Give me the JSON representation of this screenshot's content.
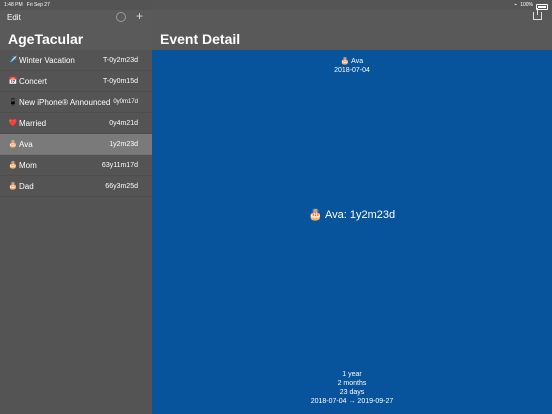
{
  "status": {
    "time": "1:48 PM",
    "date": "Fri Sep 27",
    "battery": "100%"
  },
  "sidebar": {
    "edit_label": "Edit",
    "add_label": "+",
    "title": "AgeTacular",
    "items": [
      {
        "emoji": "✈️",
        "name": "Winter Vacation",
        "age": "T-0y2m23d"
      },
      {
        "emoji": "📅",
        "name": "Concert",
        "age": "T-0y0m15d"
      },
      {
        "emoji": "📱",
        "name": "New iPhone® Announced",
        "age": "0y0m17d"
      },
      {
        "emoji": "❤️",
        "name": "Married",
        "age": "0y4m21d"
      },
      {
        "emoji": "🎂",
        "name": "Ava",
        "age": "1y2m23d"
      },
      {
        "emoji": "🎂",
        "name": "Mom",
        "age": "63y11m17d"
      },
      {
        "emoji": "🎂",
        "name": "Dad",
        "age": "66y3m25d"
      }
    ]
  },
  "detail": {
    "header_title": "Event Detail",
    "top_name": "🎂 Ava",
    "top_date": "2018-07-04",
    "big_text": "🎂 Ava: 1y2m23d",
    "breakdown": [
      "1 year",
      "2 months",
      "23 days",
      "2018-07-04 → 2019-09-27"
    ],
    "background": "#07539c"
  }
}
